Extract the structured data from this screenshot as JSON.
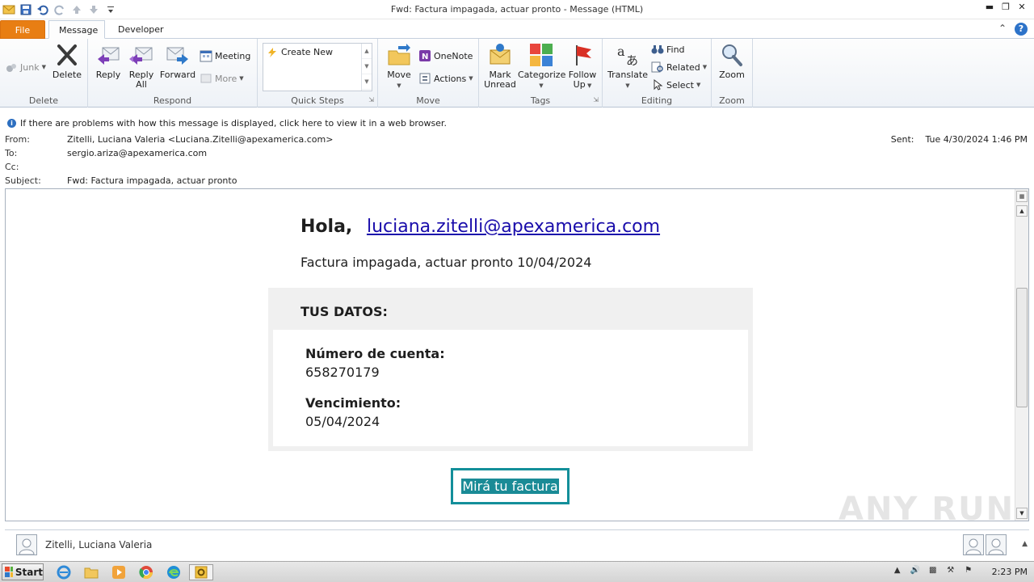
{
  "window": {
    "title": "Fwd: Factura impagada, actuar pronto  -  Message (HTML)"
  },
  "tabs": [
    {
      "label": "File"
    },
    {
      "label": "Message"
    },
    {
      "label": "Developer"
    }
  ],
  "ribbon": {
    "delete_group": {
      "label": "Delete",
      "junk": "Junk",
      "delete": "Delete"
    },
    "respond_group": {
      "label": "Respond",
      "reply": "Reply",
      "reply_all_1": "Reply",
      "reply_all_2": "All",
      "forward": "Forward",
      "meeting": "Meeting",
      "more": "More"
    },
    "quicksteps_group": {
      "label": "Quick Steps",
      "create_new": "Create New"
    },
    "move_group": {
      "label": "Move",
      "move": "Move",
      "onenote": "OneNote",
      "actions": "Actions"
    },
    "tags_group": {
      "label": "Tags",
      "mark_unread_1": "Mark",
      "mark_unread_2": "Unread",
      "categorize": "Categorize",
      "follow_up_1": "Follow",
      "follow_up_2": "Up"
    },
    "editing_group": {
      "label": "Editing",
      "translate": "Translate",
      "find": "Find",
      "related": "Related",
      "select": "Select"
    },
    "zoom_group": {
      "label": "Zoom",
      "zoom": "Zoom"
    }
  },
  "message_header": {
    "info": "If there are problems with how this message is displayed, click here to view it in a web browser.",
    "from_label": "From:",
    "from_value": "Zitelli, Luciana Valeria <Luciana.Zitelli@apexamerica.com>",
    "to_label": "To:",
    "to_value": "sergio.ariza@apexamerica.com",
    "cc_label": "Cc:",
    "cc_value": "",
    "subject_label": "Subject:",
    "subject_value": "Fwd: Factura impagada, actuar pronto",
    "sent_label": "Sent:",
    "sent_value": "Tue 4/30/2024 1:46 PM"
  },
  "email_body": {
    "greeting": "Hola,",
    "greeting_email": "luciana.zitelli@apexamerica.com",
    "invoice_line": "Factura impagada, actuar pronto 10/04/2024",
    "datos_title": "TUS DATOS:",
    "account_label": "Número de cuenta:",
    "account_value": "658270179",
    "due_label": "Vencimiento:",
    "due_value": "05/04/2024",
    "cta": "Mirá tu factura"
  },
  "people_pane": {
    "name": "Zitelli, Luciana Valeria"
  },
  "watermark": "ANY RUN",
  "taskbar": {
    "start": "Start",
    "clock": "2:23 PM"
  },
  "colors": {
    "file_tab": "#e87e13",
    "link": "#1a0dab",
    "cta": "#138f9a"
  }
}
